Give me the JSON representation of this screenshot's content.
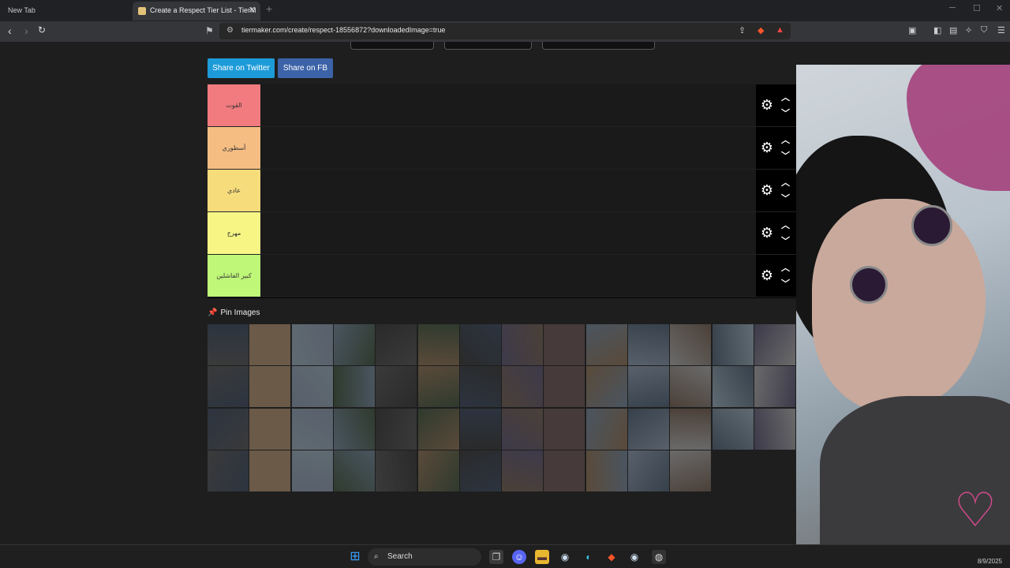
{
  "browser": {
    "tabs": [
      {
        "label": "New Tab"
      },
      {
        "label": "Create a Respect Tier List - TierM"
      }
    ],
    "url": "tiermaker.com/create/respect-18556872?downloadedImage=true"
  },
  "share": {
    "twitter_label": "Share on Twitter",
    "fb_label": "Share on FB"
  },
  "tiers": [
    {
      "label": "القوت",
      "color": "#f17b7e"
    },
    {
      "label": "أسطوري",
      "color": "#f6bd83"
    },
    {
      "label": "عادي",
      "color": "#f7dc7c"
    },
    {
      "label": "مهرج",
      "color": "#f7f685"
    },
    {
      "label": "كبير الفاشلين",
      "color": "#bff779"
    }
  ],
  "pin_images": {
    "label": "Pin Images",
    "image_count": 54
  },
  "taskbar": {
    "search_label": "Search",
    "clock_date": "8/9/2025"
  }
}
